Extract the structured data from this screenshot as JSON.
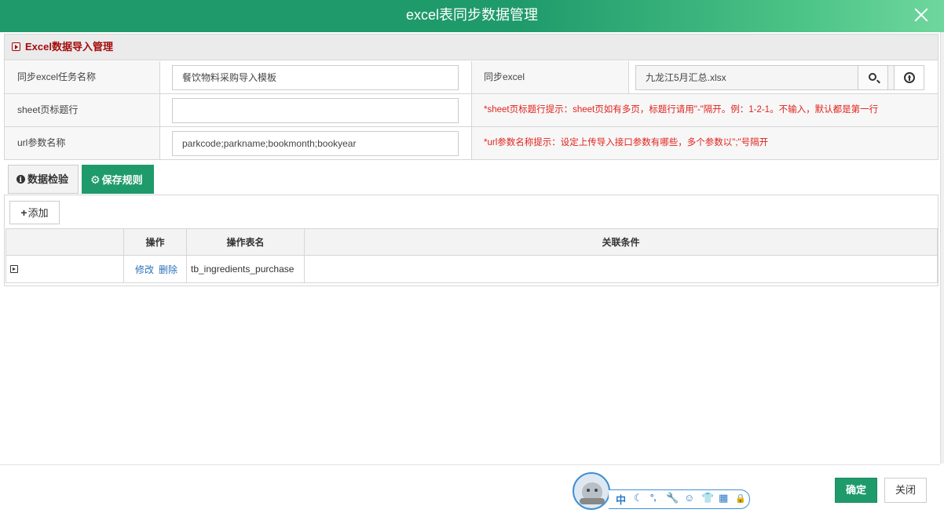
{
  "window": {
    "title": "excel表同步数据管理"
  },
  "panel": {
    "title": "Excel数据导入管理",
    "rows": [
      {
        "label": "同步excel任务名称",
        "value": "餐饮物料采购导入模板",
        "label2": "同步excel",
        "file_value": "九龙江5月汇总.xlsx"
      },
      {
        "label": "sheet页标题行",
        "value": "",
        "hint": "*sheet页标题行提示：sheet页如有多页，标题行请用\"-\"隔开。例：1-2-1。不输入，默认都是第一行"
      },
      {
        "label": "url参数名称",
        "value": "parkcode;parkname;bookmonth;bookyear",
        "hint": "*url参数名称提示：设定上传导入接口参数有哪些，多个参数以\";\"号隔开"
      }
    ]
  },
  "tabs": [
    {
      "label": "数据检验",
      "icon": "info-circle-icon"
    },
    {
      "label": "保存规则",
      "icon": "gear-icon",
      "active": true
    }
  ],
  "toolbar": {
    "add_label": "添加"
  },
  "grid": {
    "headers": [
      "",
      "操作",
      "操作表名",
      "关联条件"
    ],
    "rows": [
      {
        "edit": "修改",
        "delete": "删除",
        "table_name": "tb_ingredients_purchase",
        "condition": ""
      }
    ]
  },
  "footer": {
    "ok_label": "确定",
    "close_label": "关闭"
  },
  "ime": {
    "lang": "中",
    "punct": "°,",
    "symbols": [
      "moon-icon",
      "wrench-icon",
      "smiley-icon",
      "shirt-icon",
      "grid-icon",
      "lock-icon"
    ]
  },
  "colors": {
    "accent": "#1f9a6b",
    "title_gradient_end": "#6fd79d",
    "hint_red": "#e0231e",
    "panel_title": "#a30c0c",
    "link": "#2a73b9"
  }
}
